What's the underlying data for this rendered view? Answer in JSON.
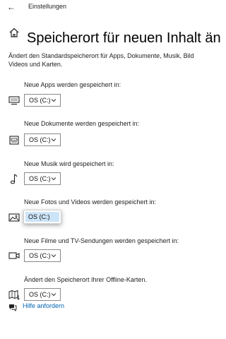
{
  "window": {
    "title": "Einstellungen"
  },
  "page": {
    "title": "Speicherort für neuen Inhalt än",
    "description_lines": [
      "Ändert den Standardspeicherort für Apps, Dokumente, Musik, Bilde",
      "Videos und Karten."
    ]
  },
  "sections": [
    {
      "label": "Neue Apps werden gespeichert in:",
      "value": "OS (C:)",
      "icon": "monitor-icon"
    },
    {
      "label": "Neue Dokumente werden gespeichert in:",
      "value": "OS (C:)",
      "icon": "documents-icon"
    },
    {
      "label": "Neue Musik wird gespeichert in:",
      "value": "OS (C:)",
      "icon": "music-note-icon"
    },
    {
      "label": "Neue Fotos und Videos werden gespeichert in:",
      "value": "OS (C:)",
      "icon": "photo-icon"
    },
    {
      "label": "Neue Filme und TV-Sendungen werden gespeichert in:",
      "value": "OS (C:)",
      "icon": "video-camera-icon"
    },
    {
      "label": "Ändert den Speicherort Ihrer Offline-Karten.",
      "value": "OS (C:)",
      "icon": "map-icon"
    }
  ],
  "help": {
    "label": "Hilfe anfordern",
    "icon": "help-chat-icon"
  },
  "colors": {
    "link": "#0066b4",
    "selection": "#cce4f7",
    "text": "#222222"
  }
}
